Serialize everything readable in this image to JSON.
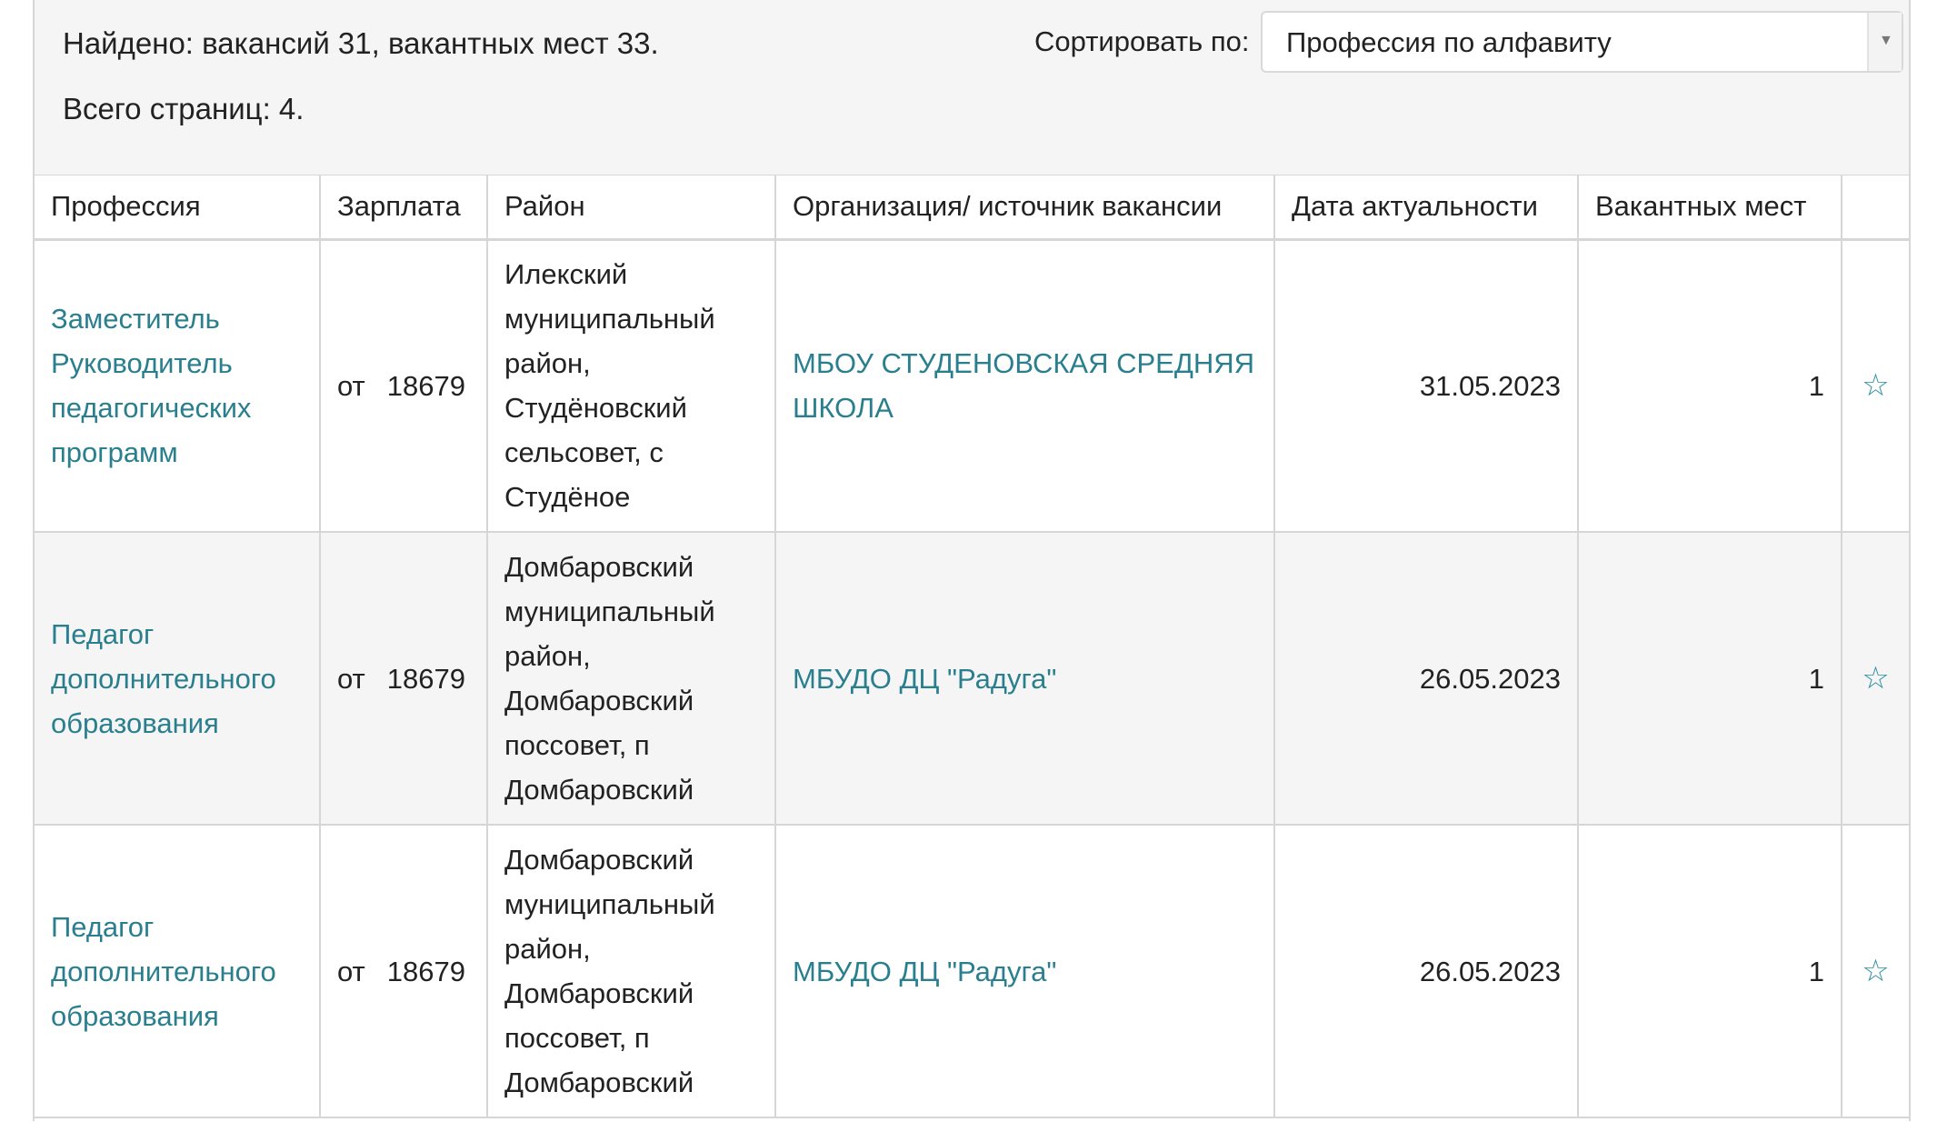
{
  "summary": {
    "found_text": "Найдено: вакансий 31, вакантных мест 33.",
    "pages_text": "Всего страниц: 4."
  },
  "sort": {
    "label": "Сортировать по:",
    "selected": "Профессия по алфавиту",
    "arrow_icon": "chevron-down-icon"
  },
  "table": {
    "headers": [
      "Профессия",
      "Зарплата",
      "Район",
      "Организация/ источник вакансии",
      "Дата актуальности",
      "Вакантных мест",
      ""
    ],
    "rows": [
      {
        "profession": "Заместитель Руководитель педагогических программ",
        "salary_prefix": "от",
        "salary_value": "18679",
        "district": "Илекский муниципальный район, Студёновский сельсовет, с Студёное",
        "organization": "МБОУ СТУДЕНОВСКАЯ СРЕДНЯЯ ШКОЛА",
        "date": "31.05.2023",
        "vacancies": "1",
        "favorite_icon": "☆"
      },
      {
        "profession": "Педагог дополнительного образования",
        "salary_prefix": "от",
        "salary_value": "18679",
        "district": "Домбаровский муниципальный район, Домбаровский поссовет, п Домбаровский",
        "organization": "МБУДО ДЦ \"Радуга\"",
        "date": "26.05.2023",
        "vacancies": "1",
        "favorite_icon": "☆"
      },
      {
        "profession": "Педагог дополнительного образования",
        "salary_prefix": "от",
        "salary_value": "18679",
        "district": "Домбаровский муниципальный район, Домбаровский поссовет, п Домбаровский",
        "organization": "МБУДО ДЦ \"Радуга\"",
        "date": "26.05.2023",
        "vacancies": "1",
        "favorite_icon": "☆"
      }
    ]
  },
  "colors": {
    "link": "#2a7f8f",
    "star": "#2a8fa0",
    "summary_bg": "#f5f5f5",
    "border": "#d6d6d6"
  }
}
